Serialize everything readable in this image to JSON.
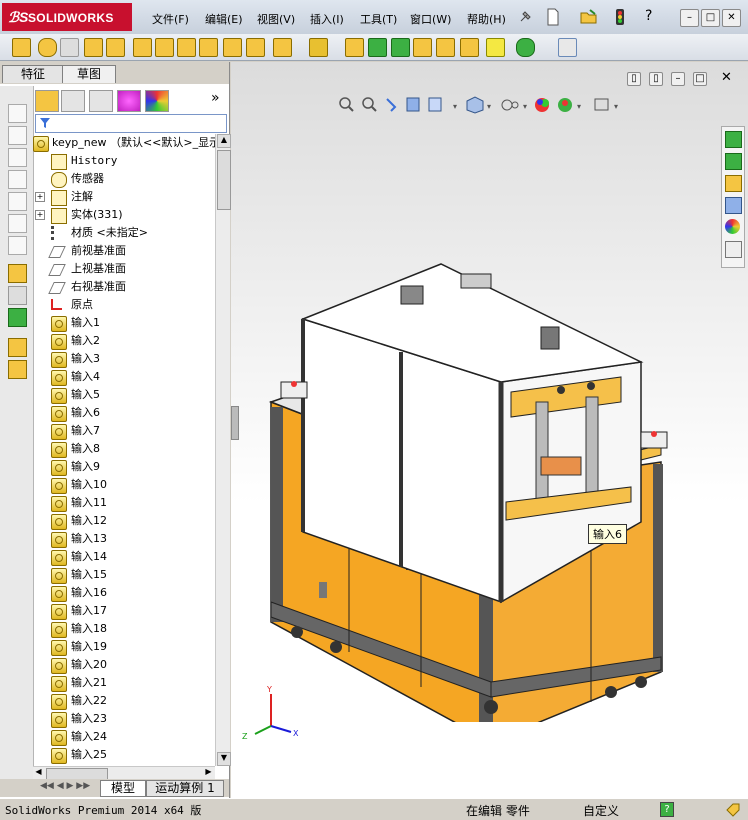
{
  "app": {
    "logo_ds": "ℬS",
    "logo_name": "SOLIDWORKS"
  },
  "menu": [
    "文件(F)",
    "编辑(E)",
    "视图(V)",
    "插入(I)",
    "工具(T)",
    "窗口(W)",
    "帮助(H)"
  ],
  "panel_tabs": [
    "特征",
    "草图"
  ],
  "tree": {
    "root": "keyp_new （默认<<默认>_显示",
    "items": [
      {
        "label": "History",
        "icon": "history-folder-icon"
      },
      {
        "label": "传感器",
        "icon": "sensor-icon"
      },
      {
        "label": "注解",
        "icon": "annotation-icon",
        "expand": "+"
      },
      {
        "label": "实体(331)",
        "icon": "solid-bodies-icon",
        "expand": "+"
      },
      {
        "label": "材质 <未指定>",
        "icon": "material-icon"
      },
      {
        "label": "前视基准面",
        "icon": "plane-icon"
      },
      {
        "label": "上视基准面",
        "icon": "plane-icon"
      },
      {
        "label": "右视基准面",
        "icon": "plane-icon"
      },
      {
        "label": "原点",
        "icon": "origin-icon"
      },
      {
        "label": "输入1",
        "icon": "imported-body-icon"
      },
      {
        "label": "输入2",
        "icon": "imported-body-icon"
      },
      {
        "label": "输入3",
        "icon": "imported-body-icon"
      },
      {
        "label": "输入4",
        "icon": "imported-body-icon"
      },
      {
        "label": "输入5",
        "icon": "imported-body-icon"
      },
      {
        "label": "输入6",
        "icon": "imported-body-icon"
      },
      {
        "label": "输入7",
        "icon": "imported-body-icon"
      },
      {
        "label": "输入8",
        "icon": "imported-body-icon"
      },
      {
        "label": "输入9",
        "icon": "imported-body-icon"
      },
      {
        "label": "输入10",
        "icon": "imported-body-icon"
      },
      {
        "label": "输入11",
        "icon": "imported-body-icon"
      },
      {
        "label": "输入12",
        "icon": "imported-body-icon"
      },
      {
        "label": "输入13",
        "icon": "imported-body-icon"
      },
      {
        "label": "输入14",
        "icon": "imported-body-icon"
      },
      {
        "label": "输入15",
        "icon": "imported-body-icon"
      },
      {
        "label": "输入16",
        "icon": "imported-body-icon"
      },
      {
        "label": "输入17",
        "icon": "imported-body-icon"
      },
      {
        "label": "输入18",
        "icon": "imported-body-icon"
      },
      {
        "label": "输入19",
        "icon": "imported-body-icon"
      },
      {
        "label": "输入20",
        "icon": "imported-body-icon"
      },
      {
        "label": "输入21",
        "icon": "imported-body-icon"
      },
      {
        "label": "输入22",
        "icon": "imported-body-icon"
      },
      {
        "label": "输入23",
        "icon": "imported-body-icon"
      },
      {
        "label": "输入24",
        "icon": "imported-body-icon"
      },
      {
        "label": "输入25",
        "icon": "imported-body-icon"
      }
    ]
  },
  "bottom_tabs": [
    "模型",
    "运动算例 1"
  ],
  "tooltip": "输入6",
  "triad": {
    "x": "X",
    "y": "Y",
    "z": "Z"
  },
  "status": {
    "product": "SolidWorks Premium 2014 x64 版",
    "mode": "在编辑 零件",
    "units": "自定义",
    "help": "?"
  },
  "colors": {
    "brand": "#c8102e",
    "cabinet": "#f5a623",
    "frame": "#3a3a3a"
  }
}
